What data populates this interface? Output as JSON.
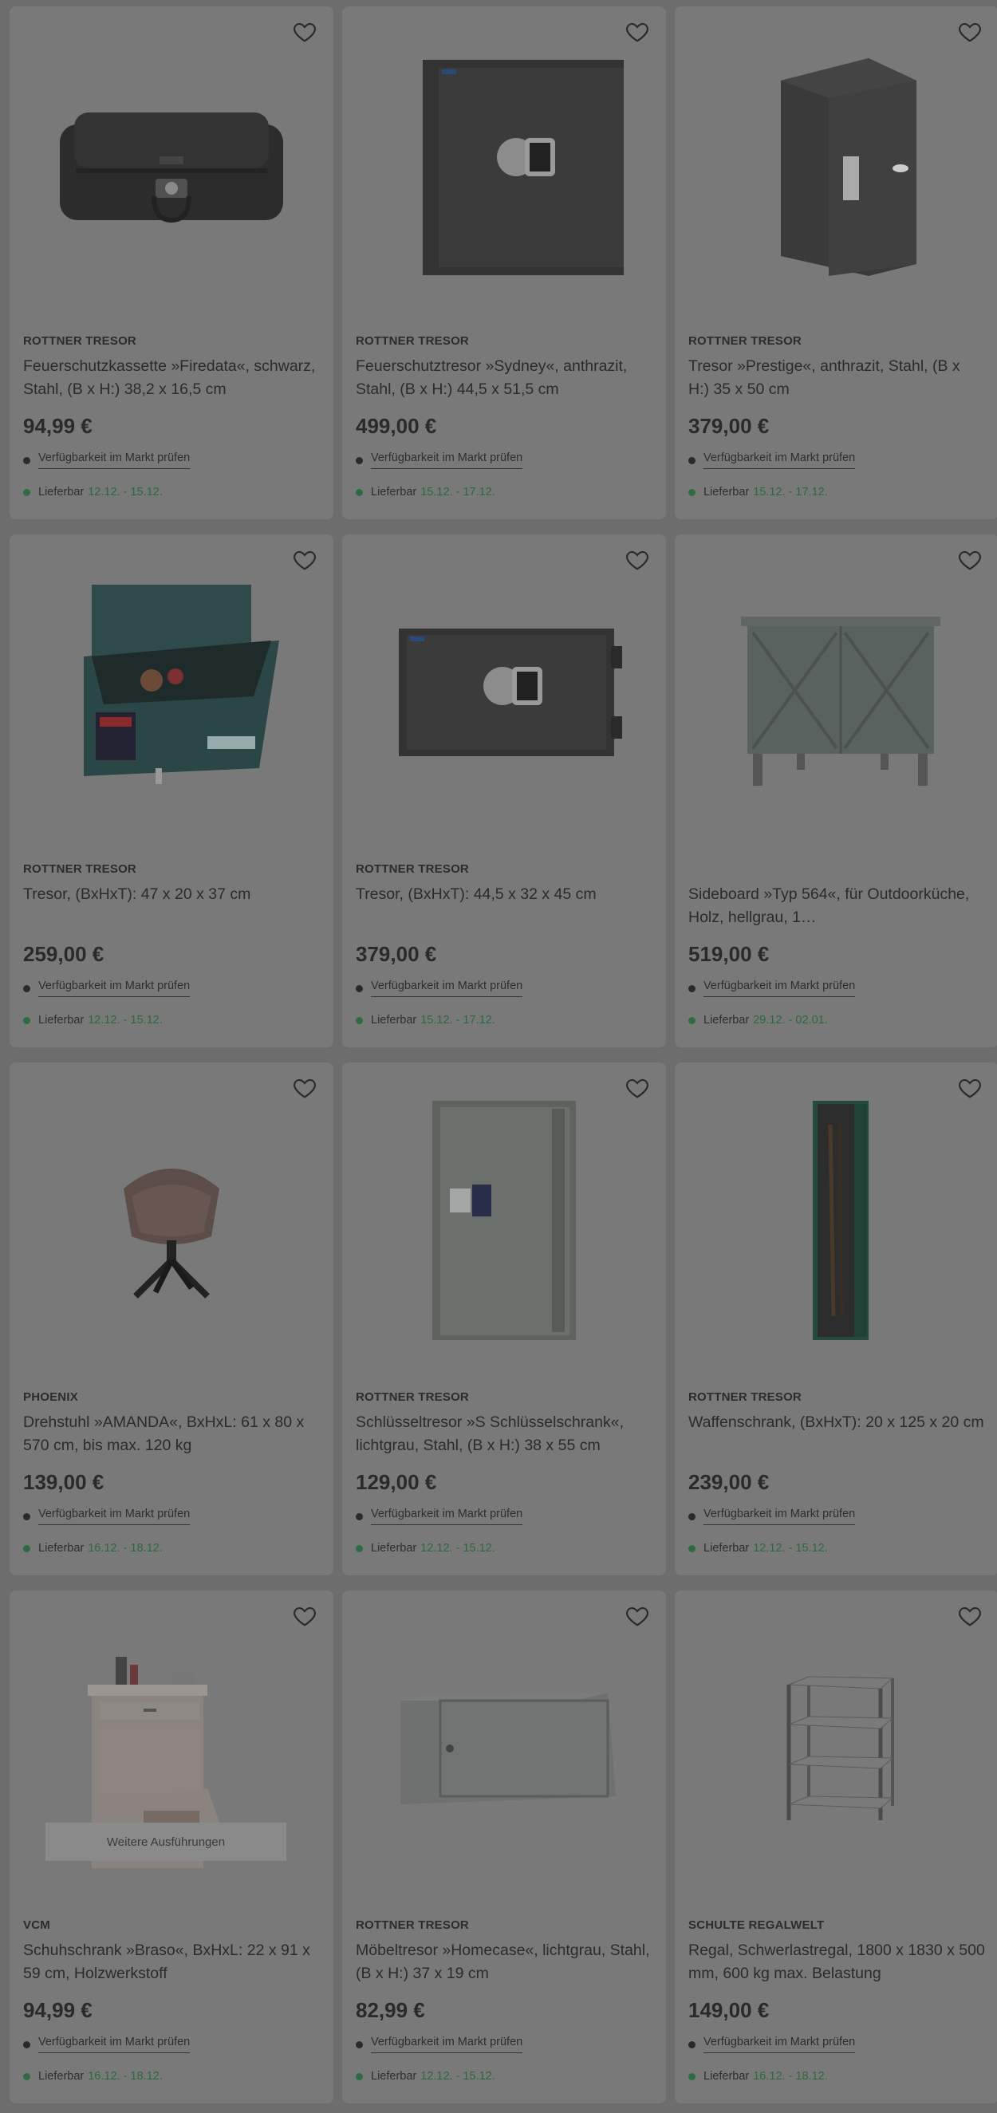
{
  "products": [
    {
      "brand": "ROTTNER TRESOR",
      "title": "Feuerschutzkassette »Firedata«, schwarz, Stahl, (B x H:) 38,2 x 16,5 cm",
      "price": "94,99 €",
      "availability_link": "Verfügbarkeit im Markt prüfen",
      "delivery_label": "Lieferbar",
      "delivery_date": "12.12. - 15.12.",
      "image": "fire-box-image"
    },
    {
      "brand": "ROTTNER TRESOR",
      "title": "Feuerschutztresor »Sydney«, anthrazit, Stahl, (B x H:) 44,5 x 51,5 cm",
      "price": "499,00 €",
      "availability_link": "Verfügbarkeit im Markt prüfen",
      "delivery_label": "Lieferbar",
      "delivery_date": "15.12. - 17.12.",
      "image": "safe-tall-keypad-image"
    },
    {
      "brand": "ROTTNER TRESOR",
      "title": "Tresor »Prestige«, anthrazit, Stahl, (B x H:) 35 x 50 cm",
      "price": "379,00 €",
      "availability_link": "Verfügbarkeit im Markt prüfen",
      "delivery_label": "Lieferbar",
      "delivery_date": "15.12. - 17.12.",
      "image": "safe-prestige-image"
    },
    {
      "brand": "ROTTNER TRESOR",
      "title": "Tresor, (BxHxT): 47 x 20 x 37 cm",
      "price": "259,00 €",
      "availability_link": "Verfügbarkeit im Markt prüfen",
      "delivery_label": "Lieferbar",
      "delivery_date": "12.12. - 15.12.",
      "image": "drawer-safe-image"
    },
    {
      "brand": "ROTTNER TRESOR",
      "title": "Tresor, (BxHxT): 44,5 x 32 x 45 cm",
      "price": "379,00 €",
      "availability_link": "Verfügbarkeit im Markt prüfen",
      "delivery_label": "Lieferbar",
      "delivery_date": "15.12. - 17.12.",
      "image": "safe-small-keypad-image"
    },
    {
      "brand": "",
      "title": "Sideboard »Typ 564«, für Outdoorküche, Holz, hellgrau, 1…",
      "price": "519,00 €",
      "availability_link": "Verfügbarkeit im Markt prüfen",
      "delivery_label": "Lieferbar",
      "delivery_date": "29.12. - 02.01.",
      "image": "sideboard-image"
    },
    {
      "brand": "PHOENIX",
      "title": "Drehstuhl »AMANDA«, BxHxL: 61 x 80 x 570 cm, bis max. 120 kg",
      "price": "139,00 €",
      "availability_link": "Verfügbarkeit im Markt prüfen",
      "delivery_label": "Lieferbar",
      "delivery_date": "16.12. - 18.12.",
      "image": "swivel-chair-image"
    },
    {
      "brand": "ROTTNER TRESOR",
      "title": "Schlüsseltresor »S Schlüsselschrank«, lichtgrau, Stahl, (B x H:) 38 x 55 cm",
      "price": "129,00 €",
      "availability_link": "Verfügbarkeit im Markt prüfen",
      "delivery_label": "Lieferbar",
      "delivery_date": "12.12. - 15.12.",
      "image": "key-cabinet-image"
    },
    {
      "brand": "ROTTNER TRESOR",
      "title": "Waffenschrank, (BxHxT): 20 x 125 x 20 cm",
      "price": "239,00 €",
      "availability_link": "Verfügbarkeit im Markt prüfen",
      "delivery_label": "Lieferbar",
      "delivery_date": "12.12. - 15.12.",
      "image": "gun-cabinet-image"
    },
    {
      "brand": "VCM",
      "title": "Schuhschrank »Braso«, BxHxL: 22 x 91 x 59 cm, Holzwerkstoff",
      "price": "94,99 €",
      "availability_link": "Verfügbarkeit im Markt prüfen",
      "delivery_label": "Lieferbar",
      "delivery_date": "16.12. - 18.12.",
      "image": "shoe-cabinet-image",
      "variant_label": "Weitere Ausführungen"
    },
    {
      "brand": "ROTTNER TRESOR",
      "title": "Möbeltresor »Homecase«, lichtgrau, Stahl, (B x H:) 37 x 19 cm",
      "price": "82,99 €",
      "availability_link": "Verfügbarkeit im Markt prüfen",
      "delivery_label": "Lieferbar",
      "delivery_date": "12.12. - 15.12.",
      "image": "furniture-safe-image"
    },
    {
      "brand": "SCHULTE REGALWELT",
      "title": "Regal, Schwerlastregal, 1800 x 1830 x 500 mm, 600 kg max. Belastung",
      "price": "149,00 €",
      "availability_link": "Verfügbarkeit im Markt prüfen",
      "delivery_label": "Lieferbar",
      "delivery_date": "16.12. - 18.12.",
      "image": "heavy-shelf-image"
    }
  ],
  "colors": {
    "overlay_bg": "#6d6d6d",
    "card_bg": "#797979",
    "delivery_green": "#2b6a3c"
  }
}
